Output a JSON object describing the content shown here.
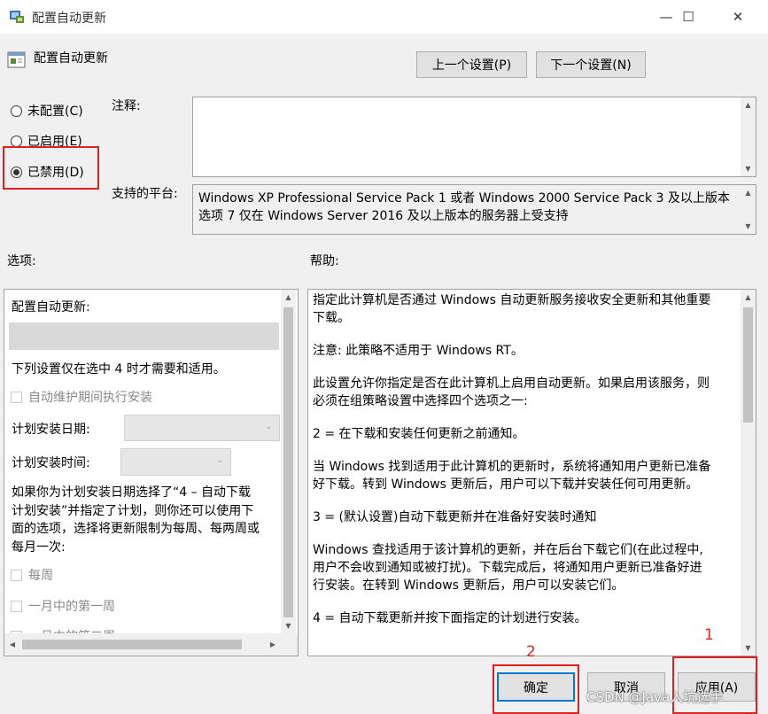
{
  "window": {
    "title": "配置自动更新",
    "minimize": "—",
    "maximize": "☐",
    "close": "✕"
  },
  "header": {
    "policy_title": "配置自动更新",
    "prev_setting": "上一个设置(P)",
    "next_setting": "下一个设置(N)"
  },
  "state": {
    "not_configured": "未配置(C)",
    "enabled": "已启用(E)",
    "disabled": "已禁用(D)",
    "selected": "disabled"
  },
  "comment": {
    "label": "注释:",
    "value": ""
  },
  "platform": {
    "label": "支持的平台:",
    "line1": "Windows XP Professional Service Pack 1 或者 Windows 2000 Service Pack 3 及以上版本",
    "line2": "选项 7 仅在 Windows Server 2016 及以上版本的服务器上受支持"
  },
  "options": {
    "label": "选项:",
    "configure_label": "配置自动更新:",
    "note": "下列设置仅在选中 4 时才需要和适用。",
    "maintenance_check": "自动维护期间执行安装",
    "schedule_day_label": "计划安装日期:",
    "schedule_time_label": "计划安装时间:",
    "para_line1": "如果你为计划安装日期选择了“4 – 自动下载",
    "para_line2": "计划安装”并指定了计划，则你还可以使用下",
    "para_line3": "面的选项，选择将更新限制为每周、每两周或",
    "para_line4": "每月一次:",
    "weekly": "每周",
    "first_week": "一月中的第一周",
    "second_week": "一月中的第二周"
  },
  "help": {
    "label": "帮助:",
    "p1a": "指定此计算机是否通过 Windows 自动更新服务接收安全更新和其他重要",
    "p1b": "下载。",
    "p2": "注意: 此策略不适用于 Windows RT。",
    "p3a": "此设置允许你指定是否在此计算机上启用自动更新。如果启用该服务，则",
    "p3b": "必须在组策略设置中选择四个选项之一:",
    "p4": " 2 = 在下载和安装任何更新之前通知。",
    "p5a": " 当 Windows 找到适用于此计算机的更新时，系统将通知用户更新已准备",
    "p5b": "好下载。转到 Windows 更新后，用户可以下载并安装任何可用更新。",
    "p6": " 3 = (默认设置)自动下载更新并在准备好安装时通知",
    "p7a": " Windows 查找适用于该计算机的更新，并在后台下载它们(在此过程中,",
    "p7b": "用户不会收到通知或被打扰)。下载完成后，将通知用户更新已准备好进",
    "p7c": "行安装。在转到 Windows 更新后，用户可以安装它们。",
    "p8": " 4 = 自动下载更新并按下面指定的计划进行安装。"
  },
  "footer": {
    "ok": "确定",
    "cancel": "取消",
    "apply": "应用(A)"
  },
  "annotations": {
    "num1": "1",
    "num2": "2",
    "watermark": "CSDN @Java入坑选手",
    "color": "#e02020"
  }
}
